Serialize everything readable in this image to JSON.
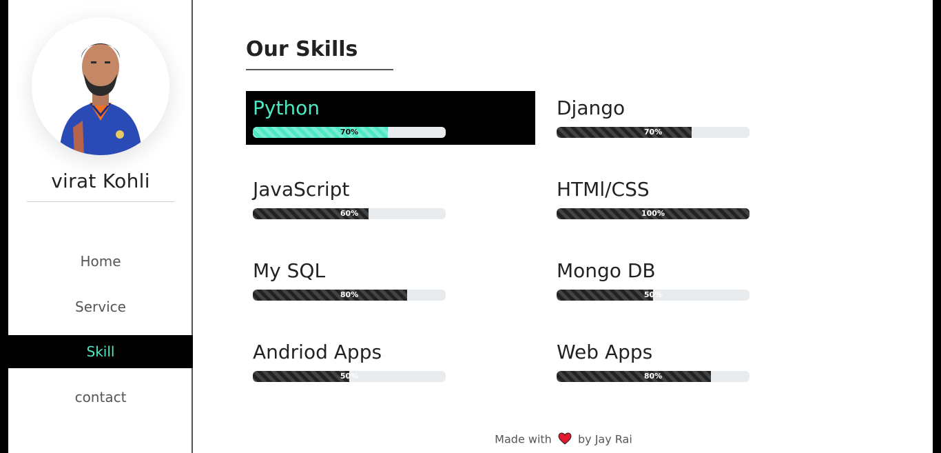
{
  "profile": {
    "name": "virat Kohli",
    "avatar_icon": "profile-photo"
  },
  "nav": [
    {
      "label": "Home",
      "active": false
    },
    {
      "label": "Service",
      "active": false
    },
    {
      "label": "Skill",
      "active": true
    },
    {
      "label": "contact",
      "active": false
    }
  ],
  "skills_title": "Our Skills",
  "skills": [
    {
      "name": "Python",
      "percent": 70,
      "percent_label": "70%",
      "active": true
    },
    {
      "name": "Django",
      "percent": 70,
      "percent_label": "70%",
      "active": false
    },
    {
      "name": "JavaScript",
      "percent": 60,
      "percent_label": "60%",
      "active": false
    },
    {
      "name": "HTMl/CSS",
      "percent": 100,
      "percent_label": "100%",
      "active": false
    },
    {
      "name": "My SQL",
      "percent": 80,
      "percent_label": "80%",
      "active": false
    },
    {
      "name": "Mongo DB",
      "percent": 50,
      "percent_label": "50%",
      "active": false
    },
    {
      "name": "Andriod Apps",
      "percent": 50,
      "percent_label": "50%",
      "active": false
    },
    {
      "name": "Web Apps",
      "percent": 80,
      "percent_label": "80%",
      "active": false
    }
  ],
  "footer": {
    "prefix": "Made with",
    "suffix": "by Jay Rai",
    "icon": "heart-icon"
  },
  "colors": {
    "accent": "#4de8c4",
    "bar_fill": "#222222",
    "bar_track": "#e9ecef",
    "active_bg": "#000000"
  }
}
